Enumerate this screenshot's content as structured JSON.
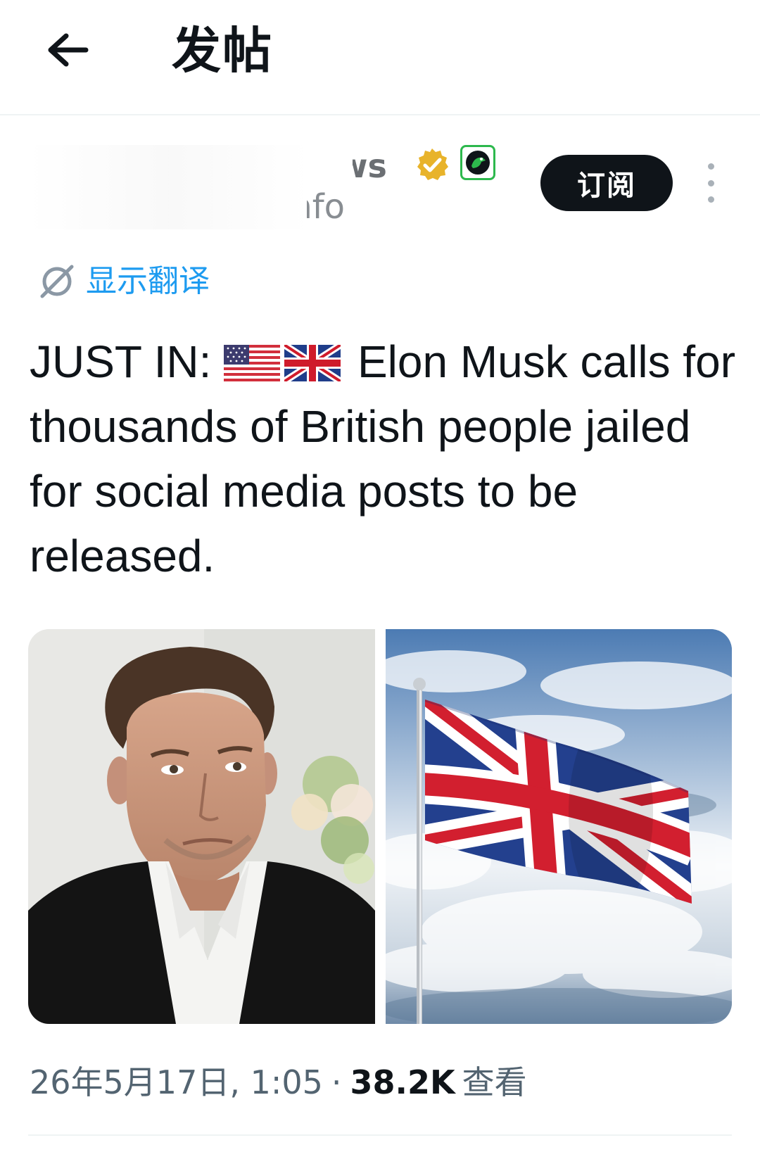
{
  "header": {
    "title": "发帖",
    "back_icon": "arrow-left-icon"
  },
  "author": {
    "display_name_partial": "ws",
    "handle_partial": "info",
    "verified_icon": "verified-gold-badge-icon",
    "affiliate_icon": "affiliate-badge-icon"
  },
  "actions": {
    "subscribe_label": "订阅",
    "more_icon": "more-vertical-icon"
  },
  "translate": {
    "label": "显示翻译",
    "icon": "globe-translate-icon"
  },
  "tweet": {
    "prefix": "JUST IN:",
    "flags": [
      "us-flag-emoji",
      "uk-flag-emoji"
    ],
    "body": "Elon Musk calls for thousands of British people jailed for social media posts to be released."
  },
  "media": {
    "left_image": "elon-musk-portrait",
    "right_image": "union-jack-flag-sky"
  },
  "meta": {
    "timestamp": "26年5月17日, 1:05",
    "separator": "·",
    "views_count": "38.2K",
    "views_label": "查看"
  },
  "colors": {
    "accent_blue": "#1d9bf0",
    "text_primary": "#0f1419",
    "text_secondary": "#536471",
    "verified_gold": "#e8b32a"
  }
}
